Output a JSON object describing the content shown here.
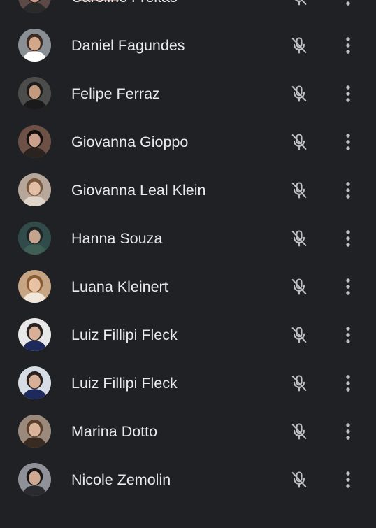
{
  "participants": [
    {
      "name": "Caroline Freitas",
      "avatar_color": "#5b4a46",
      "skin": "#c99b86",
      "hair": "#1f1a19",
      "shirt": "#2a2a2a"
    },
    {
      "name": "Daniel Fagundes",
      "avatar_color": "#8a8f96",
      "skin": "#d2a689",
      "hair": "#3a2a22",
      "shirt": "#ffffff"
    },
    {
      "name": "Felipe Ferraz",
      "avatar_color": "#4c4d4a",
      "skin": "#c49a7e",
      "hair": "#1b1b1b",
      "shirt": "#1a1a1a"
    },
    {
      "name": "Giovanna Gioppo",
      "avatar_color": "#6d5146",
      "skin": "#caa08c",
      "hair": "#140f0d",
      "shirt": "#2b2320"
    },
    {
      "name": "Giovanna Leal Klein",
      "avatar_color": "#b7a79a",
      "skin": "#e1bea6",
      "hair": "#7a5a3e",
      "shirt": "#ded4c8"
    },
    {
      "name": "Hanna Souza",
      "avatar_color": "#314a4a",
      "skin": "#c5a48f",
      "hair": "#1d2524",
      "shirt": "#3f5f55"
    },
    {
      "name": "Luana Kleinert",
      "avatar_color": "#c6a585",
      "skin": "#e8c2a4",
      "hair": "#8a5a33",
      "shirt": "#f0e6da"
    },
    {
      "name": "Luiz Fillipi Fleck",
      "avatar_color": "#e8e8e8",
      "skin": "#d8b098",
      "hair": "#2a2220",
      "shirt": "#1f2a5c"
    },
    {
      "name": "Luiz Fillipi Fleck",
      "avatar_color": "#d7dde4",
      "skin": "#d8b098",
      "hair": "#2a2220",
      "shirt": "#1f2a5c"
    },
    {
      "name": "Marina Dotto",
      "avatar_color": "#9b8a7c",
      "skin": "#d9b29a",
      "hair": "#5a3d2b",
      "shirt": "#3a2b22"
    },
    {
      "name": "Nicole Zemolin",
      "avatar_color": "#8e9197",
      "skin": "#cfa891",
      "hair": "#1a1616",
      "shirt": "#2a2a2f"
    }
  ],
  "colors": {
    "background": "#202124",
    "text": "#e8eaed",
    "icon": "#bdc1c6"
  },
  "icons": {
    "mic": "microphone-off-icon",
    "menu": "more-vertical-icon"
  }
}
